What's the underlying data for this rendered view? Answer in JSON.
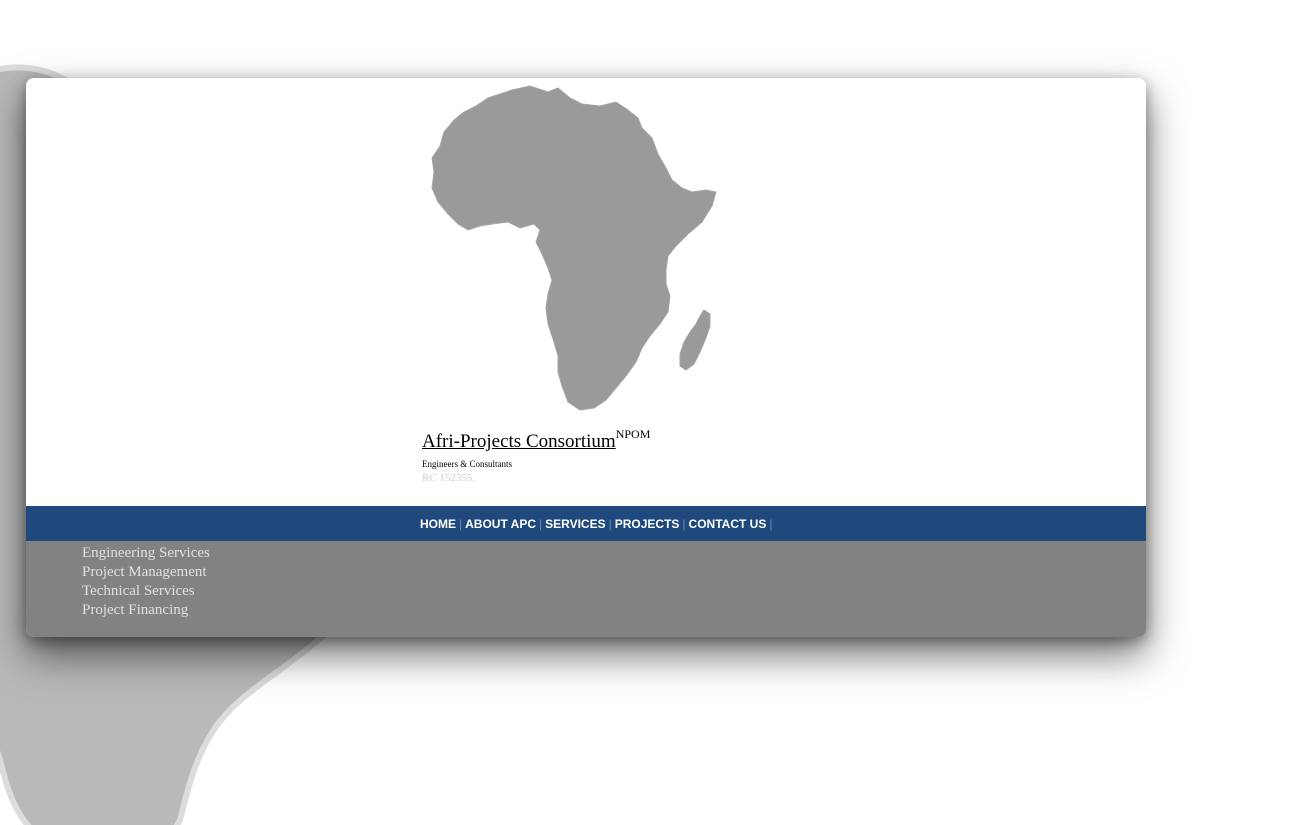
{
  "brand": {
    "name": "Afri-Projects Consortium",
    "superscript": "NPOM",
    "tagline": "Engineers & Consultants",
    "registration": "RC 152355."
  },
  "nav": {
    "items": [
      {
        "label": "HOME"
      },
      {
        "label": "ABOUT APC"
      },
      {
        "label": "SERVICES"
      },
      {
        "label": "PROJECTS"
      },
      {
        "label": "CONTACT US"
      }
    ]
  },
  "services_menu": {
    "items": [
      {
        "label": "Engineering Services"
      },
      {
        "label": "Project Management"
      },
      {
        "label": "Technical Services"
      },
      {
        "label": "Project Financing"
      }
    ]
  },
  "colors": {
    "nav_bar": "#1f497d",
    "submenu_bg": "#828282",
    "africa_logo": "#9a9a9a",
    "africa_background": "#b9b9b9"
  },
  "icons": {
    "logo": "africa-map-icon",
    "background": "africa-map-background"
  }
}
